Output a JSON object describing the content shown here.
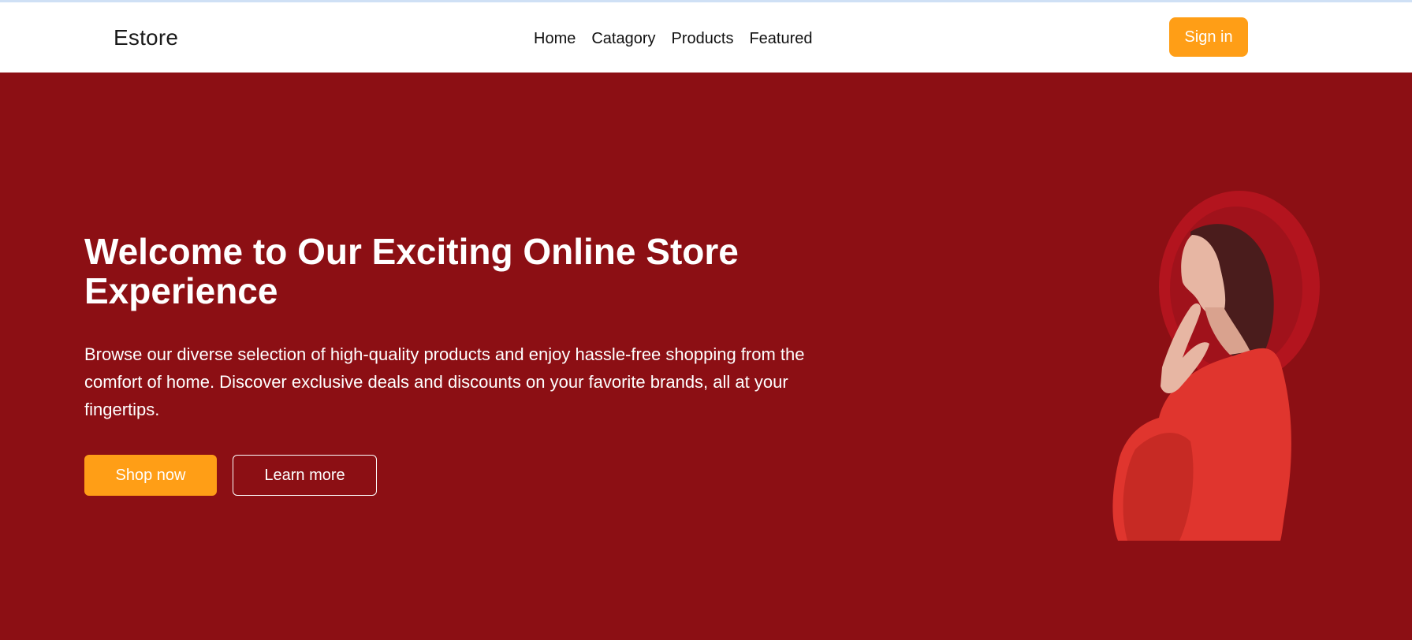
{
  "header": {
    "brand": "Estore",
    "nav": [
      "Home",
      "Catagory",
      "Products",
      "Featured"
    ],
    "signin_label": "Sign in"
  },
  "hero": {
    "title": "Welcome to Our Exciting Online Store Experience",
    "description": "Browse our diverse selection of high-quality products and enjoy hassle-free shopping from the comfort of home. Discover exclusive deals and discounts on your favorite brands, all at your fingertips.",
    "shop_label": "Shop now",
    "learn_label": "Learn more",
    "image": "woman-in-red-hat-photo"
  },
  "colors": {
    "hero_background": "#8c0f14",
    "accent": "#ff9e16",
    "navbar_background": "#ffffff"
  }
}
